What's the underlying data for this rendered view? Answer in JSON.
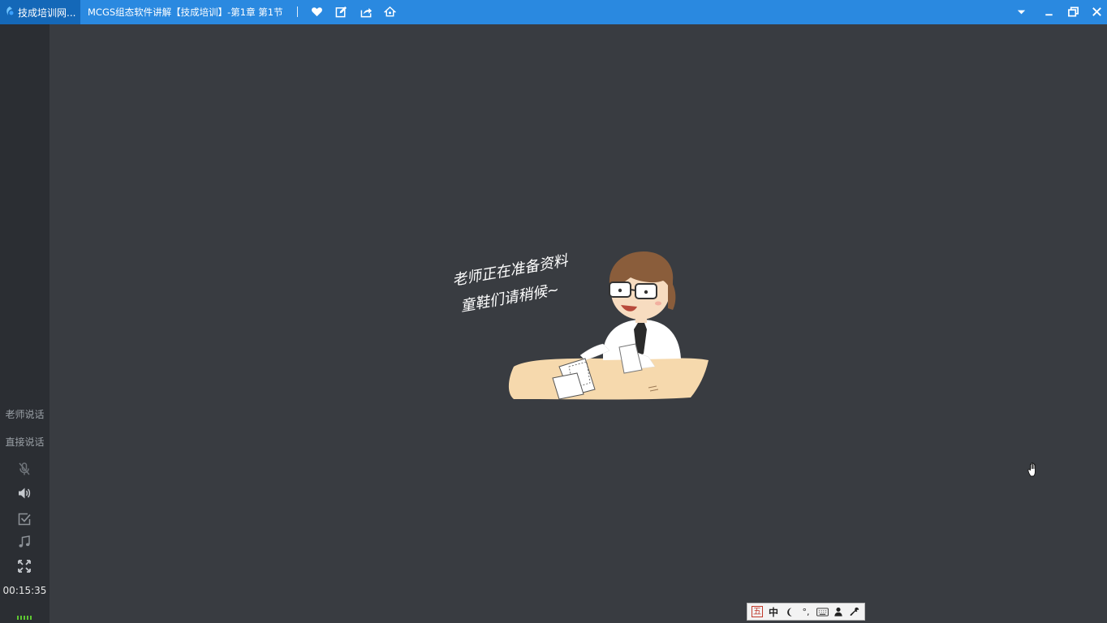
{
  "titlebar": {
    "app_tab_label": "技成培训网...",
    "window_title": "MCGS组态软件讲解【技成培训】-第1章 第1节",
    "accent_color": "#2a89e0",
    "tab_color": "#1468b8",
    "actions": [
      {
        "name": "favorite",
        "icon": "heart-icon"
      },
      {
        "name": "edit",
        "icon": "edit-icon"
      },
      {
        "name": "share",
        "icon": "share-icon"
      },
      {
        "name": "settings",
        "icon": "home-icon"
      }
    ],
    "window_controls": [
      "dropdown-icon",
      "minimize-icon",
      "restore-icon",
      "close-icon"
    ]
  },
  "sidebar": {
    "teacher_speaking": "老师说话",
    "direct_speak": "直接说话",
    "icons": [
      "mic-muted-icon",
      "speaker-icon",
      "checkbox-icon",
      "music-icon",
      "fullscreen-icon"
    ],
    "timer": "00:15:35",
    "level_color": "#5ec832"
  },
  "main": {
    "message_line1": "老师正在准备资料",
    "message_line2": "童鞋们请稍候~"
  },
  "ime": {
    "logo_char": "五",
    "mode_char": "中",
    "punct": "°,"
  }
}
